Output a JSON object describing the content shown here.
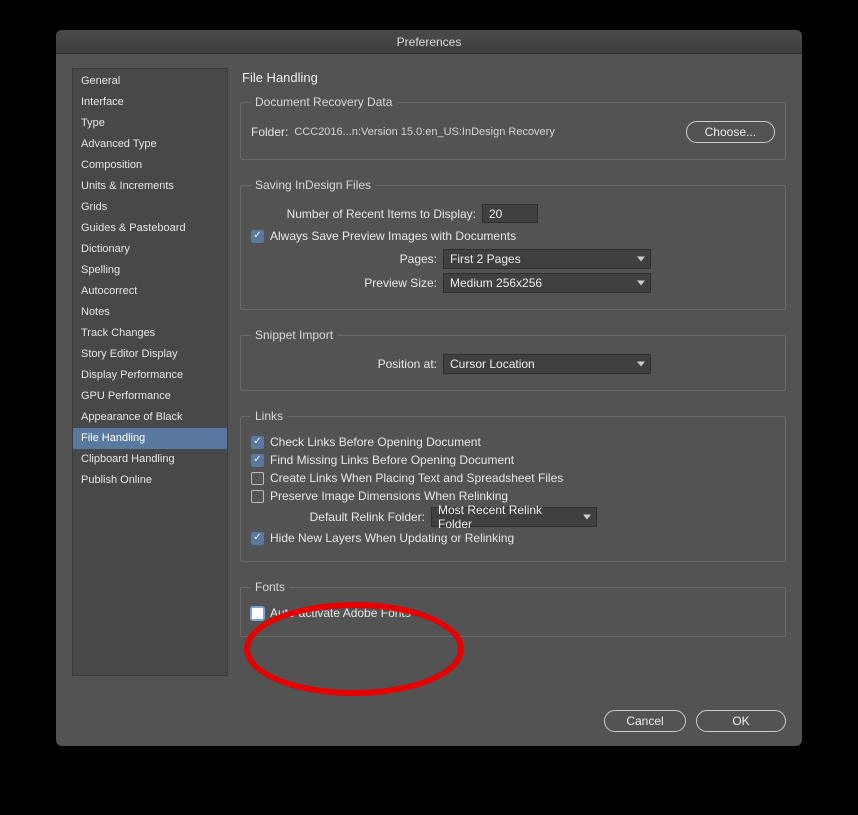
{
  "window": {
    "title": "Preferences"
  },
  "sidebar": {
    "items": [
      {
        "label": "General",
        "id": "general"
      },
      {
        "label": "Interface",
        "id": "interface"
      },
      {
        "label": "Type",
        "id": "type"
      },
      {
        "label": "Advanced Type",
        "id": "advanced-type"
      },
      {
        "label": "Composition",
        "id": "composition"
      },
      {
        "label": "Units & Increments",
        "id": "units-increments"
      },
      {
        "label": "Grids",
        "id": "grids"
      },
      {
        "label": "Guides & Pasteboard",
        "id": "guides-pasteboard"
      },
      {
        "label": "Dictionary",
        "id": "dictionary"
      },
      {
        "label": "Spelling",
        "id": "spelling"
      },
      {
        "label": "Autocorrect",
        "id": "autocorrect"
      },
      {
        "label": "Notes",
        "id": "notes"
      },
      {
        "label": "Track Changes",
        "id": "track-changes"
      },
      {
        "label": "Story Editor Display",
        "id": "story-editor-display"
      },
      {
        "label": "Display Performance",
        "id": "display-performance"
      },
      {
        "label": "GPU Performance",
        "id": "gpu-performance"
      },
      {
        "label": "Appearance of Black",
        "id": "appearance-of-black"
      },
      {
        "label": "File Handling",
        "id": "file-handling",
        "active": true
      },
      {
        "label": "Clipboard Handling",
        "id": "clipboard-handling"
      },
      {
        "label": "Publish Online",
        "id": "publish-online"
      }
    ]
  },
  "panel": {
    "title": "File Handling",
    "recovery": {
      "legend": "Document Recovery Data",
      "folder_label": "Folder:",
      "folder_path": "CCC2016...n:Version 15.0:en_US:InDesign Recovery",
      "choose_label": "Choose..."
    },
    "saving": {
      "legend": "Saving InDesign Files",
      "recent_label": "Number of Recent Items to Display:",
      "recent_value": "20",
      "save_preview_label": "Always Save Preview Images with Documents",
      "pages_label": "Pages:",
      "pages_value": "First 2 Pages",
      "preview_size_label": "Preview Size:",
      "preview_size_value": "Medium 256x256"
    },
    "snippet": {
      "legend": "Snippet Import",
      "position_label": "Position at:",
      "position_value": "Cursor Location"
    },
    "links": {
      "legend": "Links",
      "check_links_label": "Check Links Before Opening Document",
      "find_missing_label": "Find Missing Links Before Opening Document",
      "create_links_label": "Create Links When Placing Text and Spreadsheet Files",
      "preserve_dims_label": "Preserve Image Dimensions When Relinking",
      "default_relink_label": "Default Relink Folder:",
      "default_relink_value": "Most Recent Relink Folder",
      "hide_layers_label": "Hide New Layers When Updating or Relinking"
    },
    "fonts": {
      "legend": "Fonts",
      "auto_activate_label": "Auto-activate Adobe Fonts"
    }
  },
  "buttons": {
    "cancel": "Cancel",
    "ok": "OK"
  }
}
